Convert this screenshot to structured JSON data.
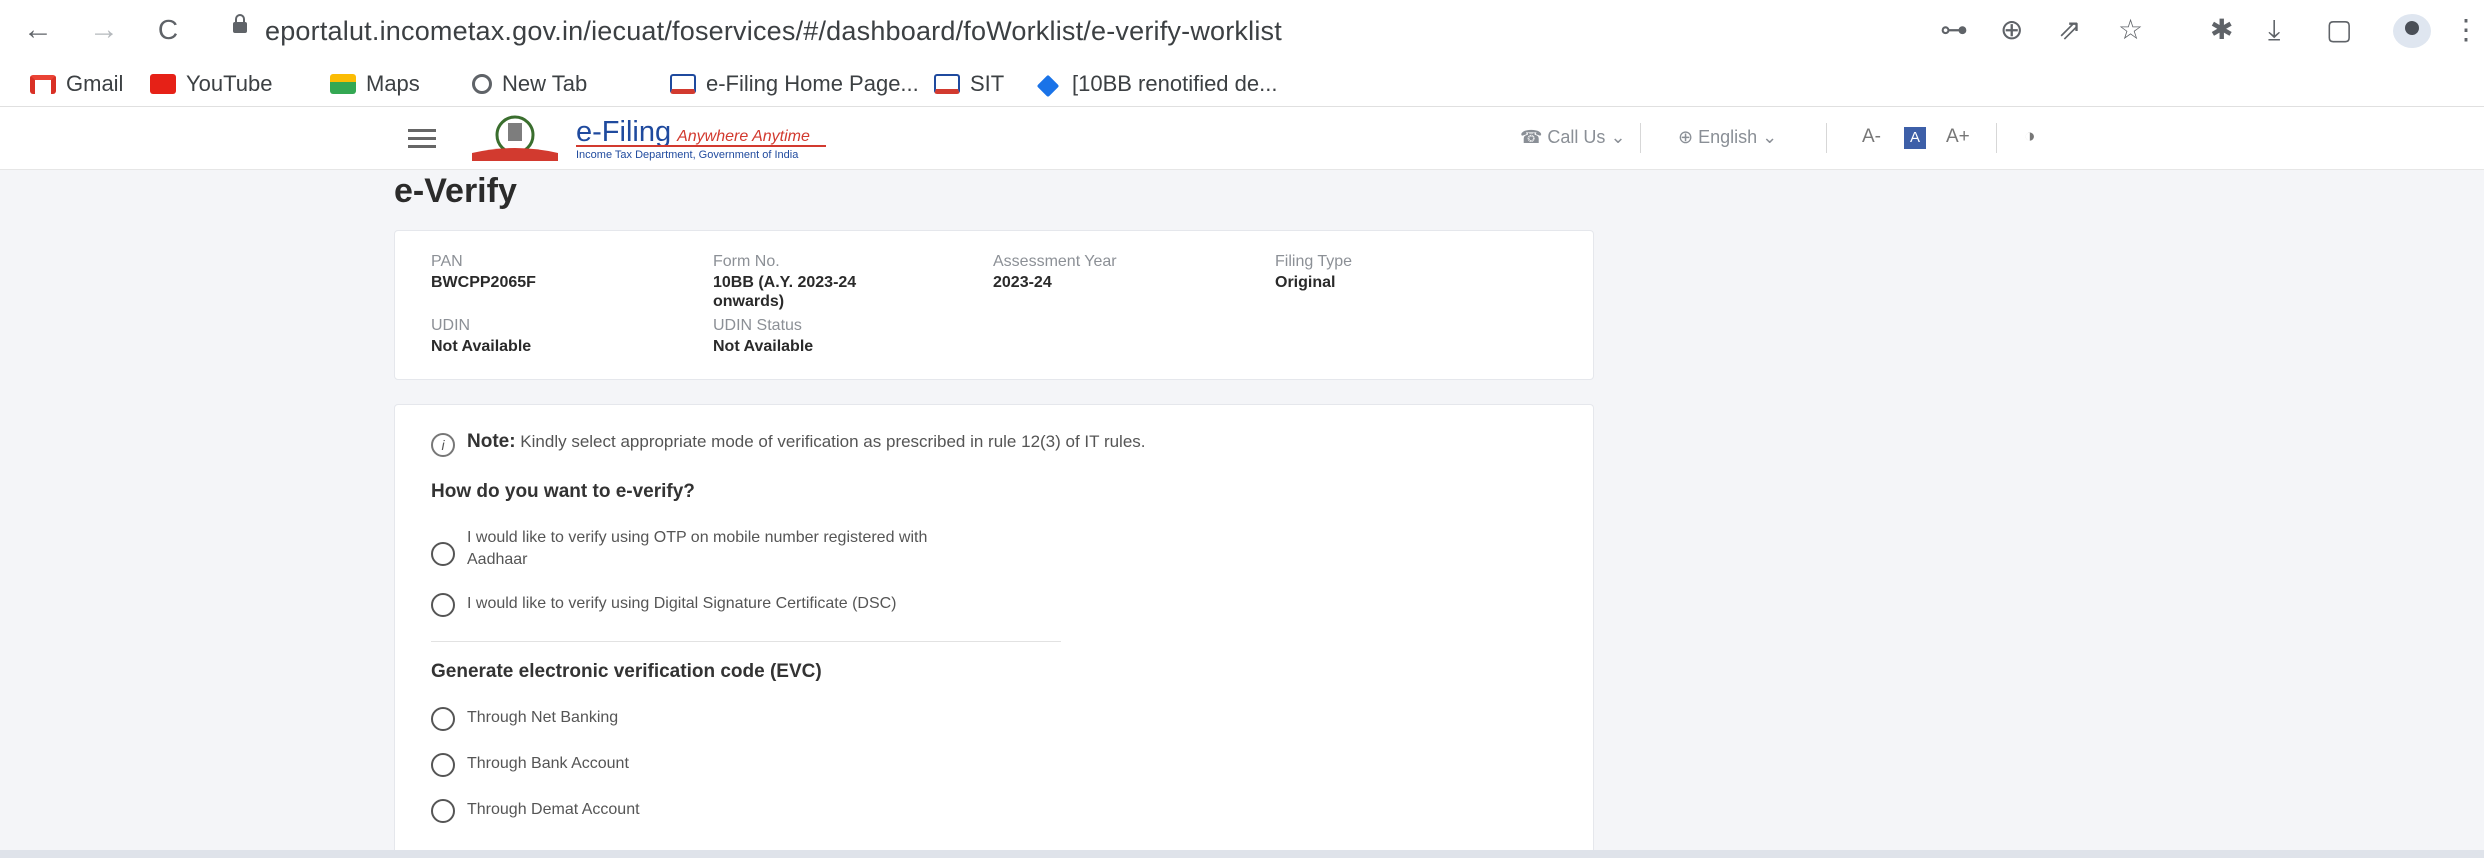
{
  "browser": {
    "url": "eportalut.incometax.gov.in/iecuat/foservices/#/dashboard/foWorklist/e-verify-worklist",
    "back": "←",
    "forward": "→",
    "reload": "C",
    "right_icons": [
      "⊶",
      "⊕",
      "⇗",
      "☆",
      "✱",
      "⤓",
      "▢",
      "⋮"
    ]
  },
  "bookmarks": [
    {
      "label": "Gmail",
      "icon": "gmail-icon",
      "color": "#d93025"
    },
    {
      "label": "YouTube",
      "icon": "youtube-icon",
      "color": "#e62117"
    },
    {
      "label": "Maps",
      "icon": "maps-icon",
      "color": "#34a853"
    },
    {
      "label": "New Tab",
      "icon": "chrome-icon",
      "color": "#5f6368"
    },
    {
      "label": "e-Filing Home Page...",
      "icon": "efiling-icon",
      "color": "#1f4a9e"
    },
    {
      "label": "SIT",
      "icon": "efiling-icon",
      "color": "#1f4a9e"
    },
    {
      "label": "[10BB renotified de...",
      "icon": "diamond-icon",
      "color": "#1a73e8"
    }
  ],
  "header": {
    "logo_title": "e-Filing",
    "logo_tagline": "Anywhere Anytime",
    "logo_subtitle": "Income Tax Department, Government of India",
    "call_us": "Call Us",
    "language": "English",
    "font_decrease": "A-",
    "font_normal": "A",
    "font_increase": "A+",
    "contrast": "◑"
  },
  "page": {
    "title": "e-Verify"
  },
  "details": {
    "pan_label": "PAN",
    "pan_value": "BWCPP2065F",
    "form_label": "Form No.",
    "form_value_line1": "10BB (A.Y. 2023-24",
    "form_value_line2": "onwards)",
    "ay_label": "Assessment Year",
    "ay_value": "2023-24",
    "filing_label": "Filing Type",
    "filing_value": "Original",
    "udin_label": "UDIN",
    "udin_value": "Not Available",
    "udin_status_label": "UDIN Status",
    "udin_status_value": "Not Available"
  },
  "verify": {
    "note_label": "Note:",
    "note_text": "Kindly select appropriate mode of verification as prescribed in rule 12(3) of IT rules.",
    "question": "How do you want to e-verify?",
    "option_otp_line1": "I would like to verify using OTP on mobile number registered with",
    "option_otp_line2": "Aadhaar",
    "option_dsc": "I would like to verify using Digital Signature Certificate (DSC)",
    "evc_heading": "Generate electronic verification code (EVC)",
    "option_netbanking": "Through Net Banking",
    "option_bank": "Through Bank Account",
    "option_demat": "Through Demat Account"
  }
}
